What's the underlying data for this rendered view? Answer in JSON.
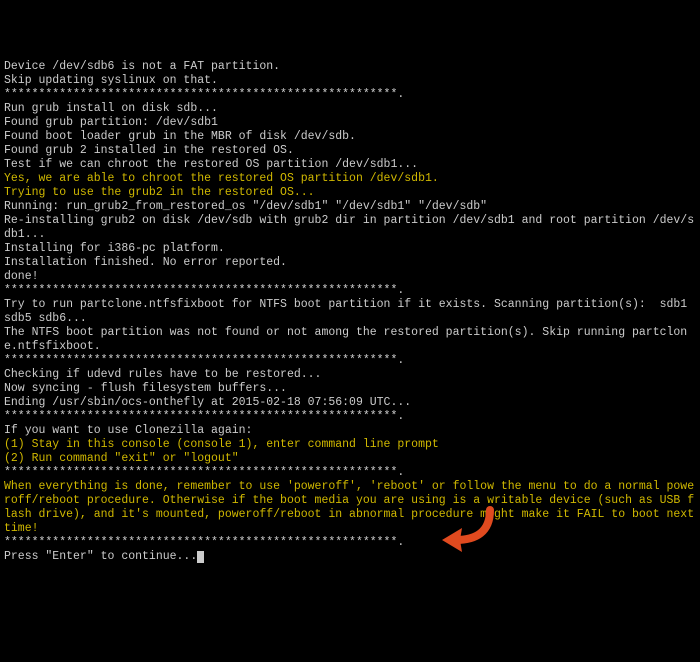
{
  "lines": [
    {
      "text": "Device /dev/sdb6 is not a FAT partition.",
      "class": "white"
    },
    {
      "text": "Skip updating syslinux on that.",
      "class": "white"
    },
    {
      "text": "*********************************************************.",
      "class": "white"
    },
    {
      "text": "Run grub install on disk sdb...",
      "class": "white"
    },
    {
      "text": "Found grub partition: /dev/sdb1",
      "class": "white"
    },
    {
      "text": "Found boot loader grub in the MBR of disk /dev/sdb.",
      "class": "white"
    },
    {
      "text": "Found grub 2 installed in the restored OS.",
      "class": "white"
    },
    {
      "text": "Test if we can chroot the restored OS partition /dev/sdb1...",
      "class": "white"
    },
    {
      "text": "Yes, we are able to chroot the restored OS partition /dev/sdb1.",
      "class": "yellow"
    },
    {
      "text": "Trying to use the grub2 in the restored OS...",
      "class": "yellow"
    },
    {
      "text": "Running: run_grub2_from_restored_os \"/dev/sdb1\" \"/dev/sdb1\" \"/dev/sdb\"",
      "class": "white"
    },
    {
      "text": "Re-installing grub2 on disk /dev/sdb with grub2 dir in partition /dev/sdb1 and root partition /dev/sdb1...",
      "class": "white"
    },
    {
      "text": "Installing for i386-pc platform.",
      "class": "white"
    },
    {
      "text": "Installation finished. No error reported.",
      "class": "white"
    },
    {
      "text": "done!",
      "class": "white"
    },
    {
      "text": "*********************************************************.",
      "class": "white"
    },
    {
      "text": "Try to run partclone.ntfsfixboot for NTFS boot partition if it exists. Scanning partition(s):  sdb1 sdb5 sdb6...",
      "class": "white"
    },
    {
      "text": "The NTFS boot partition was not found or not among the restored partition(s). Skip running partclone.ntfsfixboot.",
      "class": "white"
    },
    {
      "text": "*********************************************************.",
      "class": "white"
    },
    {
      "text": "Checking if udevd rules have to be restored...",
      "class": "white"
    },
    {
      "text": "Now syncing - flush filesystem buffers...",
      "class": "white"
    },
    {
      "text": "",
      "class": "white"
    },
    {
      "text": "Ending /usr/sbin/ocs-onthefly at 2015-02-18 07:56:09 UTC...",
      "class": "white"
    },
    {
      "text": "*********************************************************.",
      "class": "white"
    },
    {
      "text": "If you want to use Clonezilla again:",
      "class": "white"
    },
    {
      "text": "(1) Stay in this console (console 1), enter command line prompt",
      "class": "yellow"
    },
    {
      "text": "(2) Run command \"exit\" or \"logout\"",
      "class": "yellow"
    },
    {
      "text": "*********************************************************.",
      "class": "white"
    },
    {
      "text": "When everything is done, remember to use 'poweroff', 'reboot' or follow the menu to do a normal poweroff/reboot procedure. Otherwise if the boot media you are using is a writable device (such as USB flash drive), and it's mounted, poweroff/reboot in abnormal procedure might make it FAIL to boot next time!",
      "class": "yellow"
    },
    {
      "text": "*********************************************************.",
      "class": "white"
    },
    {
      "text": "Press \"Enter\" to continue...",
      "class": "white",
      "cursor": true
    }
  ],
  "arrow": {
    "color": "#e04a1f"
  }
}
